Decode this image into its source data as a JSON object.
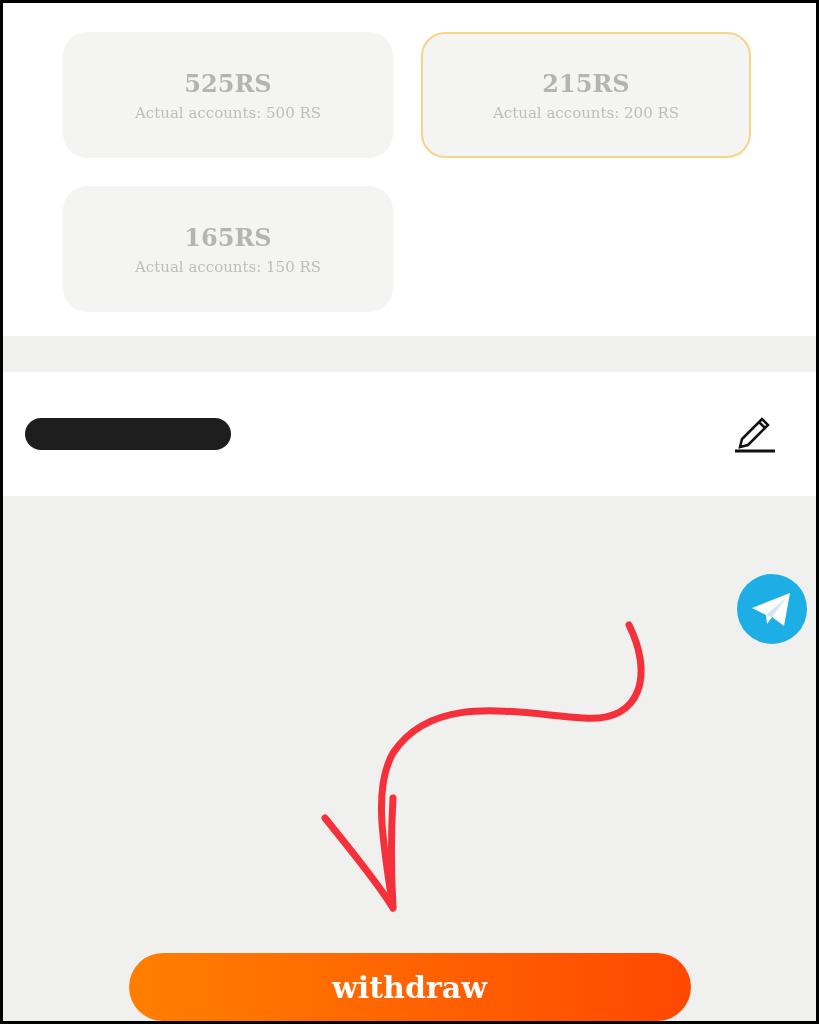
{
  "plans": [
    {
      "amount": "525RS",
      "actual": "Actual accounts: 500 RS",
      "selected": false
    },
    {
      "amount": "215RS",
      "actual": "Actual accounts: 200 RS",
      "selected": true
    },
    {
      "amount": "165RS",
      "actual": "Actual accounts: 150 RS",
      "selected": false
    }
  ],
  "withdraw_button": {
    "label": "withdraw"
  }
}
